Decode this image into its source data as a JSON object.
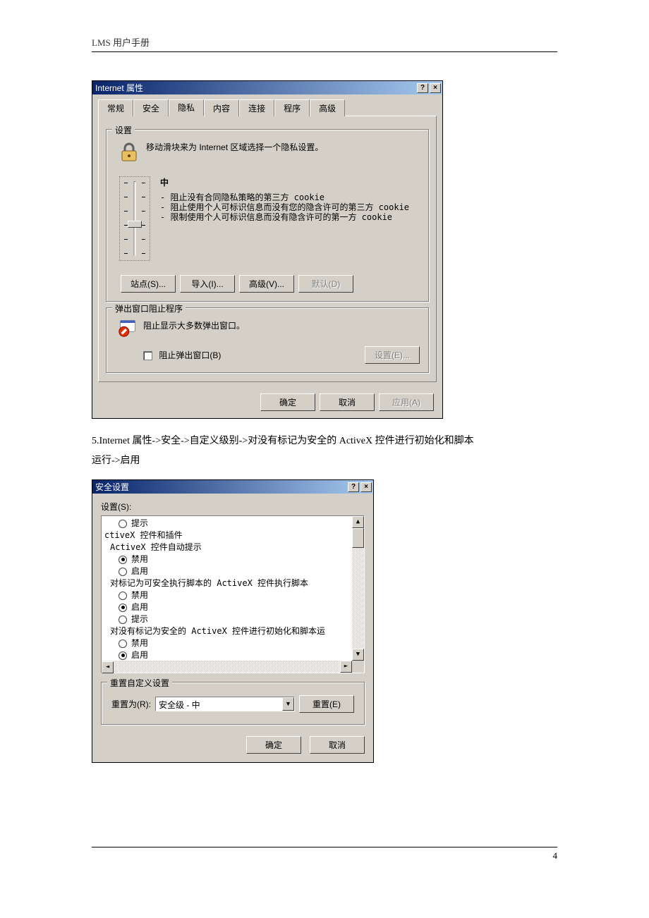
{
  "doc": {
    "header": "LMS 用户手册",
    "page_number": "4",
    "step_text_1": "5.Internet  属性->安全->自定义级别->对没有标记为安全的 ActiveX 控件进行初始化和脚本",
    "step_text_2": "运行->启用"
  },
  "dlg1": {
    "title": "Internet 属性",
    "tabs": [
      "常规",
      "安全",
      "隐私",
      "内容",
      "连接",
      "程序",
      "高级"
    ],
    "active_tab": "隐私",
    "settings": {
      "group_title": "设置",
      "desc": "移动滑块来为 Internet 区域选择一个隐私设置。",
      "level": "中",
      "bullets": [
        "阻止没有合同隐私策略的第三方 cookie",
        "阻止使用个人可标识信息而没有您的隐含许可的第三方 cookie",
        "限制使用个人可标识信息而没有隐含许可的第一方 cookie"
      ],
      "buttons": {
        "sites": "站点(S)...",
        "import": "导入(I)...",
        "advanced": "高级(V)...",
        "default": "默认(D)"
      }
    },
    "popup": {
      "group_title": "弹出窗口阻止程序",
      "desc": "阻止显示大多数弹出窗口。",
      "checkbox": "阻止弹出窗口(B)",
      "settings_btn": "设置(E)..."
    },
    "bottom": {
      "ok": "确定",
      "cancel": "取消",
      "apply": "应用(A)"
    }
  },
  "dlg2": {
    "title": "安全设置",
    "label": "设置(S):",
    "tree": {
      "prompt": "提示",
      "cat1": "ctiveX 控件和插件",
      "sub1": "ActiveX 控件自动提示",
      "sub1_opts": {
        "disable": "禁用",
        "enable": "启用"
      },
      "sub2": "对标记为可安全执行脚本的 ActiveX 控件执行脚本",
      "sub2_opts": {
        "disable": "禁用",
        "enable": "启用",
        "prompt": "提示"
      },
      "sub3": "对没有标记为安全的 ActiveX 控件进行初始化和脚本运",
      "sub3_opts": {
        "disable": "禁用",
        "enable": "启用"
      }
    },
    "reset": {
      "group_title": "重置自定义设置",
      "label": "重置为(R):",
      "value": "安全级 - 中",
      "button": "重置(E)"
    },
    "bottom": {
      "ok": "确定",
      "cancel": "取消"
    }
  }
}
